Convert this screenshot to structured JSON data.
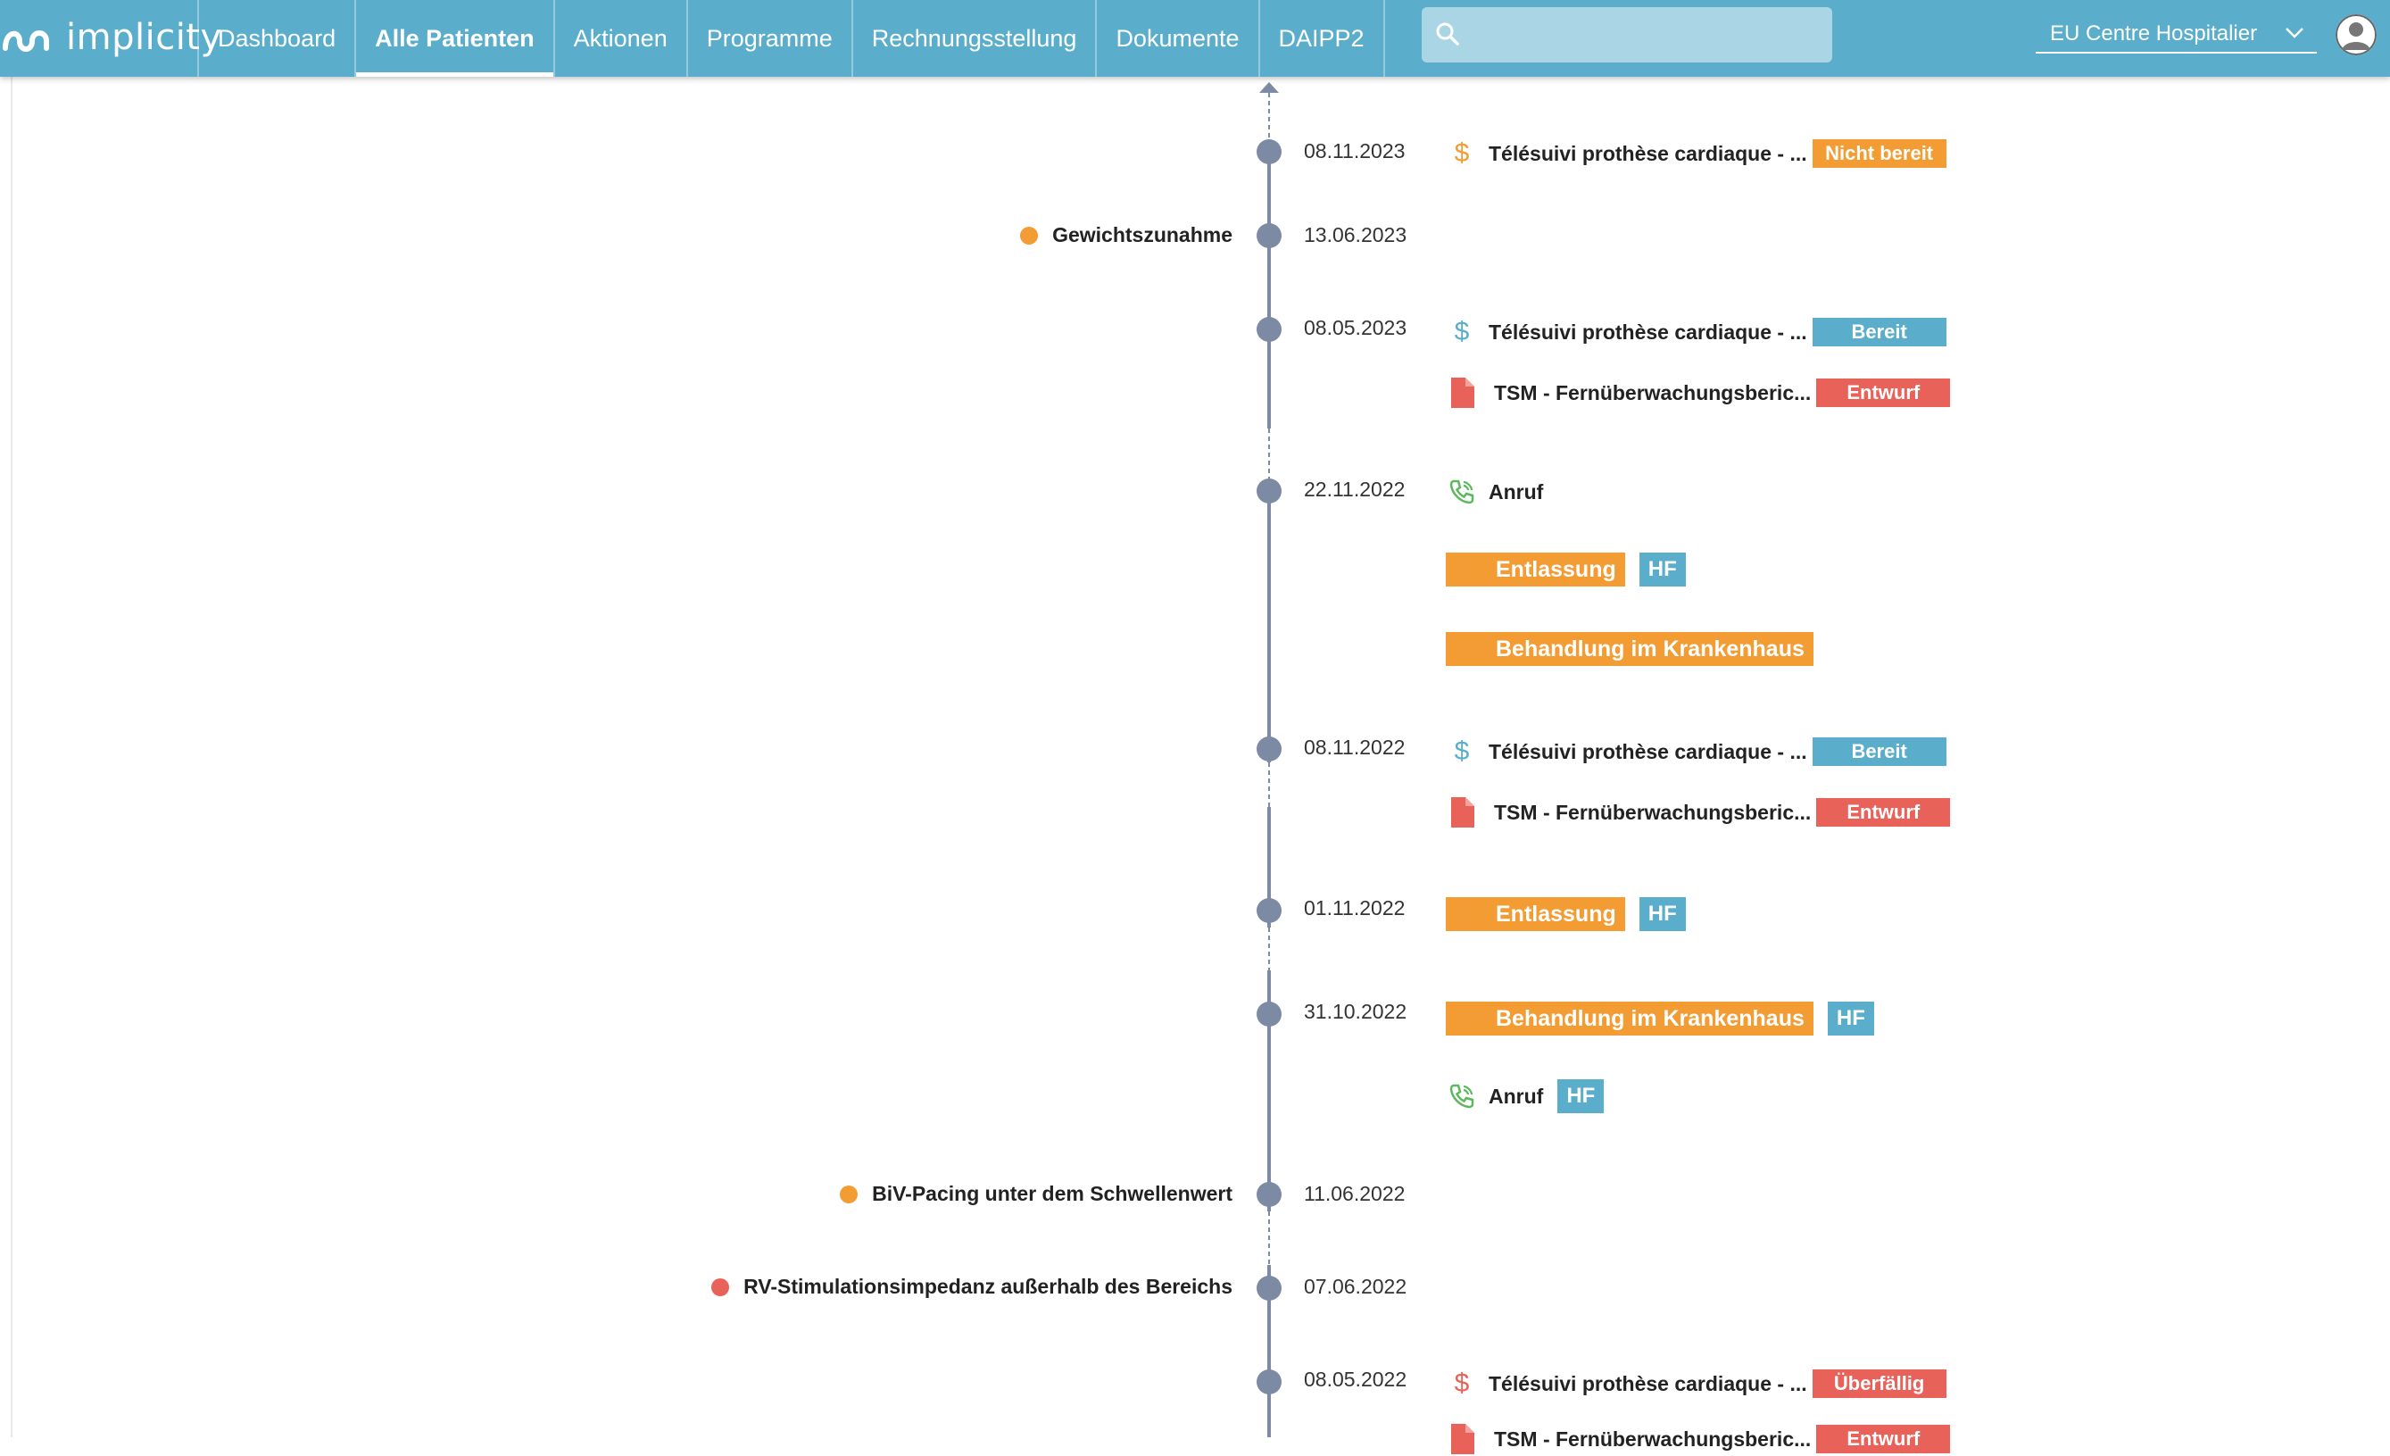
{
  "app": {
    "logo_text": "implicity"
  },
  "nav": {
    "items": [
      "Dashboard",
      "Alle Patienten",
      "Aktionen",
      "Programme",
      "Rechnungsstellung",
      "Dokumente",
      "DAIPP2"
    ],
    "active": "Alle Patienten"
  },
  "search": {
    "value": "",
    "placeholder": ""
  },
  "center": {
    "selected": "EU Centre Hospitalier"
  },
  "timeline": {
    "entries": [
      {
        "date": "08.11.2023",
        "events": [
          {
            "kind": "billing",
            "icon": "dollar-icon",
            "icon_color": "#f39c33",
            "title": "Télésuivi prothèse cardiaque - ...",
            "status": "Nicht bereit",
            "status_color": "orange"
          }
        ]
      },
      {
        "date": "13.06.2023",
        "alert": {
          "label": "Gewichtszunahme",
          "color": "#f39c33"
        }
      },
      {
        "date": "08.05.2023",
        "events": [
          {
            "kind": "billing",
            "icon": "dollar-icon",
            "icon_color": "#5aaecb",
            "title": "Télésuivi prothèse cardiaque - ...",
            "status": "Bereit",
            "status_color": "blue"
          },
          {
            "kind": "document",
            "icon": "document-icon",
            "icon_color": "#e8625a",
            "title": "TSM - Fernüberwachungsberic...",
            "status": "Entwurf",
            "status_color": "red"
          }
        ]
      },
      {
        "date": "22.11.2022",
        "events": [
          {
            "kind": "call",
            "icon": "phone-icon",
            "icon_color": "#5cb85c",
            "title": "Anruf"
          },
          {
            "kind": "tag",
            "title": "Entlassung",
            "program": "HF"
          },
          {
            "kind": "tag",
            "title": "Behandlung im Krankenhaus"
          }
        ]
      },
      {
        "date": "08.11.2022",
        "events": [
          {
            "kind": "billing",
            "icon": "dollar-icon",
            "icon_color": "#5aaecb",
            "title": "Télésuivi prothèse cardiaque - ...",
            "status": "Bereit",
            "status_color": "blue"
          },
          {
            "kind": "document",
            "icon": "document-icon",
            "icon_color": "#e8625a",
            "title": "TSM - Fernüberwachungsberic...",
            "status": "Entwurf",
            "status_color": "red"
          }
        ]
      },
      {
        "date": "01.11.2022",
        "events": [
          {
            "kind": "tag",
            "title": "Entlassung",
            "program": "HF"
          }
        ]
      },
      {
        "date": "31.10.2022",
        "events": [
          {
            "kind": "tag",
            "title": "Behandlung im Krankenhaus",
            "program": "HF"
          },
          {
            "kind": "call",
            "icon": "phone-icon",
            "icon_color": "#5cb85c",
            "title": "Anruf",
            "program": "HF"
          }
        ]
      },
      {
        "date": "11.06.2022",
        "alert": {
          "label": "BiV-Pacing unter dem Schwellenwert",
          "color": "#f39c33"
        }
      },
      {
        "date": "07.06.2022",
        "alert": {
          "label": "RV-Stimulationsimpedanz außerhalb des Bereichs",
          "color": "#e8625a"
        }
      },
      {
        "date": "08.05.2022",
        "events": [
          {
            "kind": "billing",
            "icon": "dollar-icon",
            "icon_color": "#e8625a",
            "title": "Télésuivi prothèse cardiaque - ...",
            "status": "Überfällig",
            "status_color": "red"
          },
          {
            "kind": "document",
            "icon": "document-icon",
            "icon_color": "#e8625a",
            "title": "TSM - Fernüberwachungsberic...",
            "status": "Entwurf",
            "status_color": "red"
          }
        ]
      }
    ]
  }
}
